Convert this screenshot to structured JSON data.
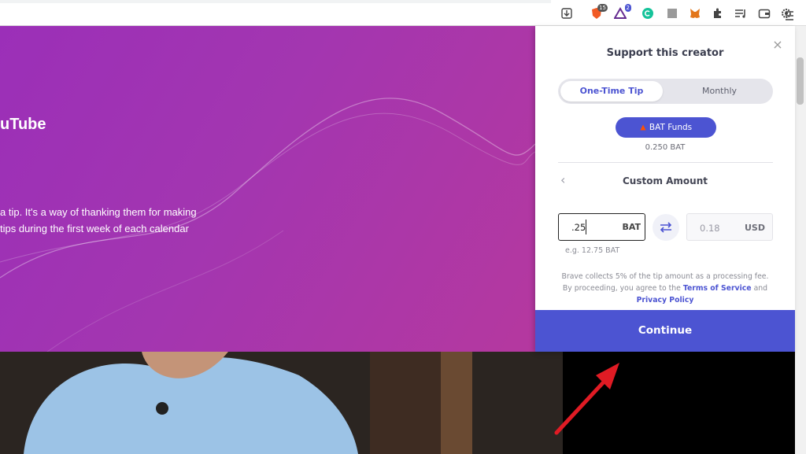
{
  "toolbar": {
    "icons": [
      "download-icon",
      "brave-shields-icon",
      "brave-rewards-icon",
      "grammarly-icon",
      "extension-gray-icon",
      "metamask-icon",
      "puzzle-icon",
      "playlist-icon",
      "wallet-icon",
      "gear-icon",
      "menu-icon"
    ],
    "shields_badge": "15",
    "rewards_badge": "2"
  },
  "banner": {
    "title_fragment": "uTube",
    "text_line1": "a tip. It's a way of thanking them for making",
    "text_line2": "tips during the first week of each calendar"
  },
  "panel": {
    "title": "Support this creator",
    "close": "×",
    "tabs": [
      {
        "label": "One-Time Tip",
        "active": true
      },
      {
        "label": "Monthly",
        "active": false
      }
    ],
    "funds_label": "BAT Funds",
    "funds_amount": "0.250 BAT",
    "custom_amount_label": "Custom Amount",
    "bat_value": ".25",
    "bat_unit": "BAT",
    "usd_value": "0.18",
    "usd_unit": "USD",
    "example": "e.g. 12.75 BAT",
    "fine_print_1": "Brave collects 5% of the tip amount as a processing fee.",
    "fine_print_2": "By proceeding, you agree to the",
    "terms_link": "Terms of Service",
    "and_text": "and",
    "privacy_link": "Privacy Policy",
    "continue_label": "Continue"
  },
  "colors": {
    "accent": "#4c54d2",
    "banner_start": "#9b2fb8",
    "banner_end": "#b5389f",
    "arrow": "#e01b24"
  }
}
